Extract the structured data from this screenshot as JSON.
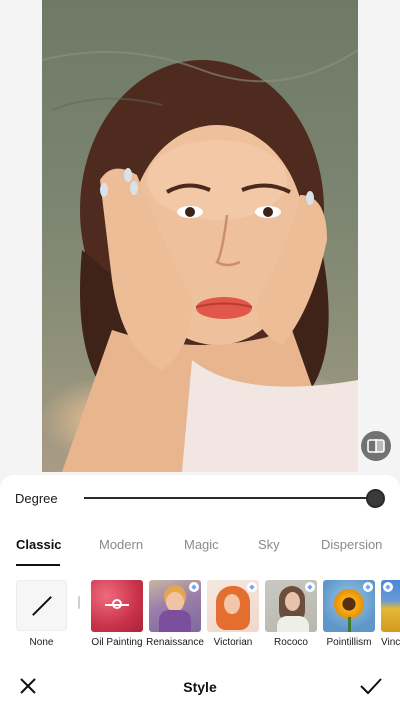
{
  "panel": {
    "degree_label": "Degree",
    "degree_value": 1.0
  },
  "tabs": [
    {
      "label": "Classic",
      "active": true
    },
    {
      "label": "Modern",
      "active": false
    },
    {
      "label": "Magic",
      "active": false
    },
    {
      "label": "Sky",
      "active": false
    },
    {
      "label": "Dispersion",
      "active": false
    }
  ],
  "styles": {
    "none_label": "None",
    "items": [
      {
        "label": "Oil Painting",
        "premium": false,
        "selected": true
      },
      {
        "label": "Renaissance",
        "premium": true,
        "selected": false
      },
      {
        "label": "Victorian",
        "premium": true,
        "selected": false
      },
      {
        "label": "Rococo",
        "premium": true,
        "selected": false
      },
      {
        "label": "Pointillism",
        "premium": true,
        "selected": false
      },
      {
        "label": "Vinc",
        "premium": true,
        "selected": false
      }
    ]
  },
  "bottom_bar": {
    "title": "Style",
    "close_icon": "close-icon",
    "confirm_icon": "checkmark-icon"
  },
  "icons": {
    "compare": "compare-icon",
    "none": "slash-icon",
    "premium": "diamond-icon"
  },
  "colors": {
    "accent": "#111111",
    "inactive_tab": "#8a8a8a",
    "oil_painting_tile": "#c9334a"
  }
}
